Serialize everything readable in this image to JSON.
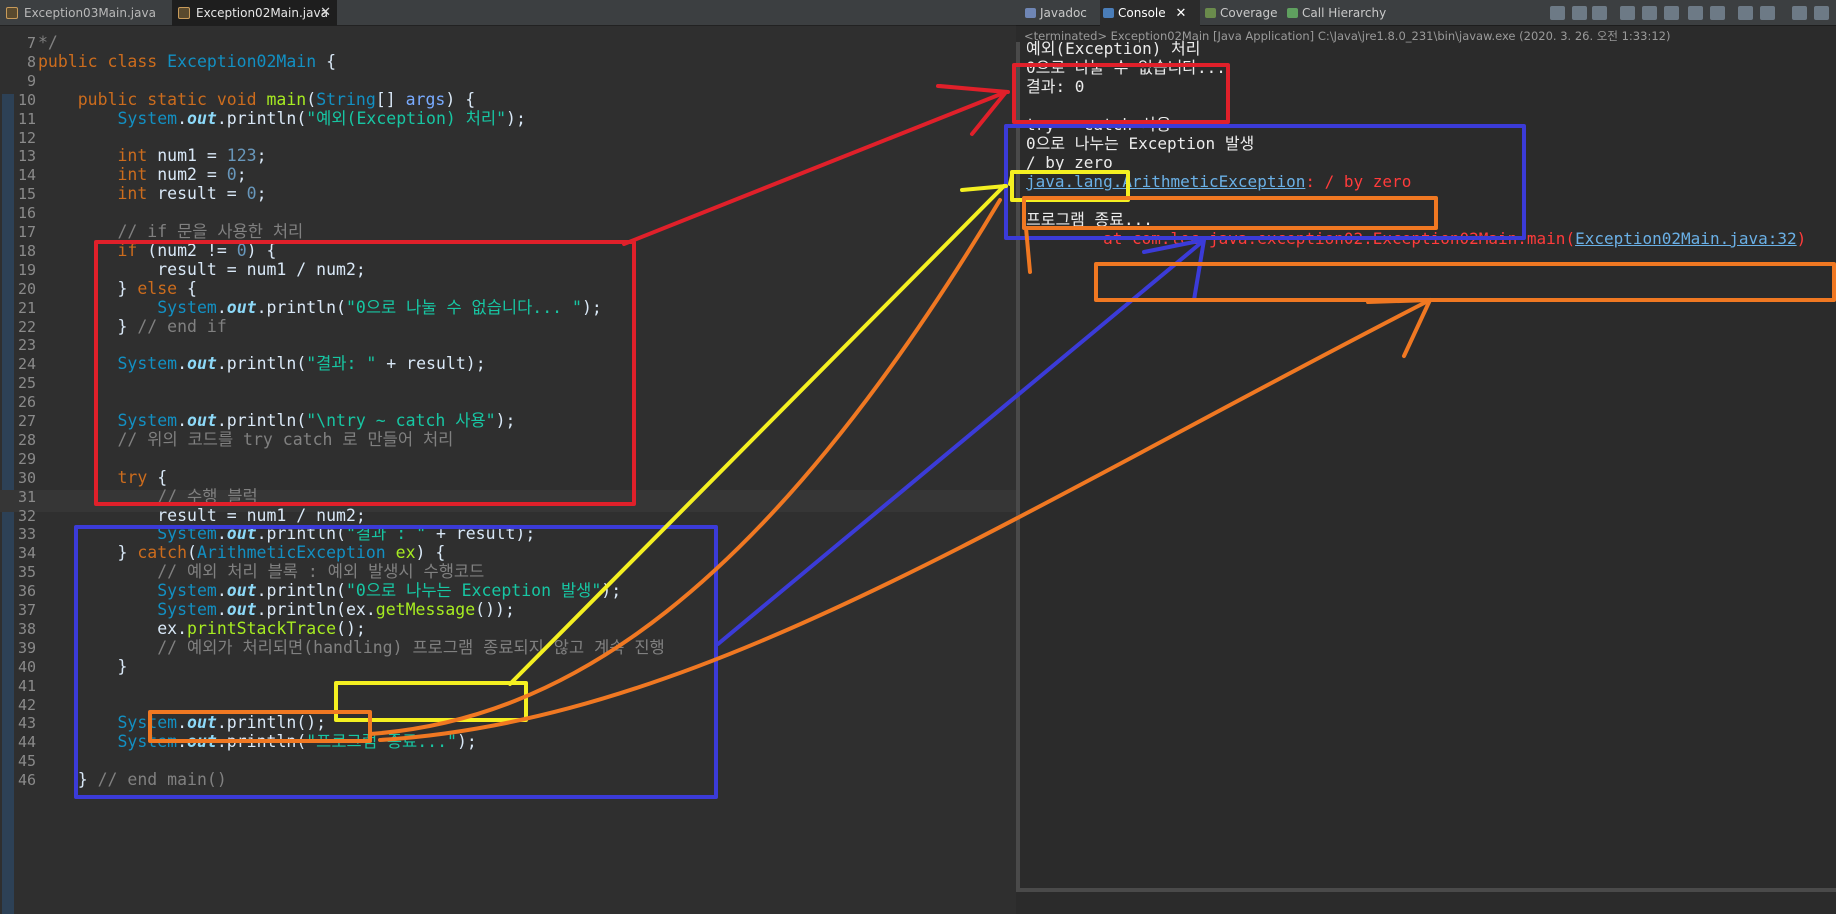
{
  "editor": {
    "tabs": [
      {
        "label": "Exception03Main.java",
        "active": false
      },
      {
        "label": "Exception02Main.java",
        "active": true,
        "close": "✕"
      }
    ],
    "lines": [
      {
        "n": "7",
        "parts": [
          [
            "cm",
            "*/"
          ]
        ]
      },
      {
        "n": "8",
        "parts": [
          [
            "kw",
            "public class "
          ],
          [
            "cls",
            "Exception02Main"
          ],
          [
            "pl",
            " {"
          ]
        ]
      },
      {
        "n": "9",
        "parts": []
      },
      {
        "n": "10",
        "parts": [
          [
            "pl",
            "    "
          ],
          [
            "kw",
            "public static void "
          ],
          [
            "mth",
            "main"
          ],
          [
            "pl",
            "("
          ],
          [
            "typ",
            "String"
          ],
          [
            "pl",
            "[] "
          ],
          [
            "var",
            "args"
          ],
          [
            "pl",
            ") {"
          ]
        ]
      },
      {
        "n": "11",
        "parts": [
          [
            "pl",
            "        "
          ],
          [
            "typ",
            "System"
          ],
          [
            "pl",
            "."
          ],
          [
            "fld",
            "out"
          ],
          [
            "pl",
            ".println("
          ],
          [
            "str",
            "\"예외(Exception) 처리\""
          ],
          [
            "pl",
            ");"
          ]
        ]
      },
      {
        "n": "12",
        "parts": []
      },
      {
        "n": "13",
        "parts": [
          [
            "pl",
            "        "
          ],
          [
            "kw",
            "int "
          ],
          [
            "pl",
            "num1 = "
          ],
          [
            "num",
            "123"
          ],
          [
            "pl",
            ";"
          ]
        ]
      },
      {
        "n": "14",
        "parts": [
          [
            "pl",
            "        "
          ],
          [
            "kw",
            "int "
          ],
          [
            "pl",
            "num2 = "
          ],
          [
            "num",
            "0"
          ],
          [
            "pl",
            ";"
          ]
        ]
      },
      {
        "n": "15",
        "parts": [
          [
            "pl",
            "        "
          ],
          [
            "kw",
            "int "
          ],
          [
            "pl",
            "result = "
          ],
          [
            "num",
            "0"
          ],
          [
            "pl",
            ";"
          ]
        ]
      },
      {
        "n": "16",
        "parts": []
      },
      {
        "n": "17",
        "parts": [
          [
            "pl",
            "        "
          ],
          [
            "cm",
            "// if 문을 사용한 처리"
          ]
        ]
      },
      {
        "n": "18",
        "parts": [
          [
            "pl",
            "        "
          ],
          [
            "kw",
            "if "
          ],
          [
            "pl",
            "(num2 != "
          ],
          [
            "num",
            "0"
          ],
          [
            "pl",
            ") {"
          ]
        ]
      },
      {
        "n": "19",
        "parts": [
          [
            "pl",
            "            result = num1 / num2;"
          ]
        ]
      },
      {
        "n": "20",
        "parts": [
          [
            "pl",
            "        } "
          ],
          [
            "kw",
            "else "
          ],
          [
            "pl",
            "{"
          ]
        ]
      },
      {
        "n": "21",
        "parts": [
          [
            "pl",
            "            "
          ],
          [
            "typ",
            "System"
          ],
          [
            "pl",
            "."
          ],
          [
            "fld",
            "out"
          ],
          [
            "pl",
            ".println("
          ],
          [
            "str",
            "\"0으로 나눌 수 없습니다... \""
          ],
          [
            "pl",
            ");"
          ]
        ]
      },
      {
        "n": "22",
        "parts": [
          [
            "pl",
            "        } "
          ],
          [
            "cm",
            "// end if"
          ]
        ]
      },
      {
        "n": "23",
        "parts": []
      },
      {
        "n": "24",
        "parts": [
          [
            "pl",
            "        "
          ],
          [
            "typ",
            "System"
          ],
          [
            "pl",
            "."
          ],
          [
            "fld",
            "out"
          ],
          [
            "pl",
            ".println("
          ],
          [
            "str",
            "\"결과: \""
          ],
          [
            "pl",
            " + result);"
          ]
        ]
      },
      {
        "n": "25",
        "parts": []
      },
      {
        "n": "26",
        "parts": []
      },
      {
        "n": "27",
        "parts": [
          [
            "pl",
            "        "
          ],
          [
            "typ",
            "System"
          ],
          [
            "pl",
            "."
          ],
          [
            "fld",
            "out"
          ],
          [
            "pl",
            ".println("
          ],
          [
            "str",
            "\"\\ntry ~ catch 사용\""
          ],
          [
            "pl",
            ");"
          ]
        ]
      },
      {
        "n": "28",
        "parts": [
          [
            "pl",
            "        "
          ],
          [
            "cm",
            "// 위의 코드를 try catch 로 만들어 처리"
          ]
        ]
      },
      {
        "n": "29",
        "parts": []
      },
      {
        "n": "30",
        "parts": [
          [
            "pl",
            "        "
          ],
          [
            "kw",
            "try "
          ],
          [
            "pl",
            "{"
          ]
        ]
      },
      {
        "n": "31",
        "parts": [
          [
            "pl",
            "            "
          ],
          [
            "cm",
            "// 수행 블럭"
          ]
        ]
      },
      {
        "n": "32",
        "parts": [
          [
            "pl",
            "            result = num1 / num2;"
          ]
        ]
      },
      {
        "n": "33",
        "parts": [
          [
            "pl",
            "            "
          ],
          [
            "typ",
            "System"
          ],
          [
            "pl",
            "."
          ],
          [
            "fld",
            "out"
          ],
          [
            "pl",
            ".println("
          ],
          [
            "str",
            "\"결과 : \""
          ],
          [
            "pl",
            " + result);"
          ]
        ]
      },
      {
        "n": "34",
        "parts": [
          [
            "pl",
            "        } "
          ],
          [
            "kw",
            "catch"
          ],
          [
            "pl",
            "("
          ],
          [
            "cls",
            "ArithmeticException "
          ],
          [
            "mth",
            "ex"
          ],
          [
            "pl",
            ") {"
          ]
        ]
      },
      {
        "n": "35",
        "parts": [
          [
            "pl",
            "            "
          ],
          [
            "cm",
            "// 예외 처리 블록 : 예외 발생시 수행코드"
          ]
        ]
      },
      {
        "n": "36",
        "parts": [
          [
            "pl",
            "            "
          ],
          [
            "typ",
            "System"
          ],
          [
            "pl",
            "."
          ],
          [
            "fld",
            "out"
          ],
          [
            "pl",
            ".println("
          ],
          [
            "str",
            "\"0으로 나누는 Exception 발생\""
          ],
          [
            "pl",
            ");"
          ]
        ]
      },
      {
        "n": "37",
        "parts": [
          [
            "pl",
            "            "
          ],
          [
            "typ",
            "System"
          ],
          [
            "pl",
            "."
          ],
          [
            "fld",
            "out"
          ],
          [
            "pl",
            ".println(ex."
          ],
          [
            "mth",
            "getMessage"
          ],
          [
            "pl",
            "());"
          ]
        ]
      },
      {
        "n": "38",
        "parts": [
          [
            "pl",
            "            ex."
          ],
          [
            "mth",
            "printStackTrace"
          ],
          [
            "pl",
            "();"
          ]
        ]
      },
      {
        "n": "39",
        "parts": [
          [
            "pl",
            "            "
          ],
          [
            "cm",
            "// 예외가 처리되면(handling) 프로그램 종료되지 않고 계속 진행"
          ]
        ]
      },
      {
        "n": "40",
        "parts": [
          [
            "pl",
            "        }"
          ]
        ]
      },
      {
        "n": "41",
        "parts": []
      },
      {
        "n": "42",
        "parts": []
      },
      {
        "n": "43",
        "parts": [
          [
            "pl",
            "        "
          ],
          [
            "typ",
            "System"
          ],
          [
            "pl",
            "."
          ],
          [
            "fld",
            "out"
          ],
          [
            "pl",
            ".println();"
          ]
        ]
      },
      {
        "n": "44",
        "parts": [
          [
            "pl",
            "        "
          ],
          [
            "typ",
            "System"
          ],
          [
            "pl",
            "."
          ],
          [
            "fld",
            "out"
          ],
          [
            "pl",
            ".println("
          ],
          [
            "str",
            "\"프로그램 종료...\""
          ],
          [
            "pl",
            ");"
          ]
        ]
      },
      {
        "n": "45",
        "parts": []
      },
      {
        "n": "46",
        "parts": [
          [
            "pl",
            "    } "
          ],
          [
            "cm",
            "// end main()"
          ]
        ]
      }
    ]
  },
  "views": {
    "tabs": [
      {
        "label": "Javadoc",
        "icon": "javadoc-icon"
      },
      {
        "label": "Console",
        "icon": "console-icon",
        "active": true,
        "close": "✕"
      },
      {
        "label": "Coverage",
        "icon": "coverage-icon"
      },
      {
        "label": "Call Hierarchy",
        "icon": "call-hierarchy-icon"
      }
    ],
    "toolbar_icons": [
      "clear-console-icon",
      "remove-launch-icon",
      "remove-all-icon",
      "scroll-lock-icon",
      "word-wrap-icon",
      "pin-console-icon",
      "display-selected-icon",
      "open-console-icon",
      "new-console-icon",
      "view-menu-icon",
      "minimize-icon",
      "maximize-icon"
    ]
  },
  "console": {
    "status": "<terminated> Exception02Main [Java Application] C:\\Java\\jre1.8.0_231\\bin\\javaw.exe (2020. 3. 26. 오전 1:33:12)",
    "lines": [
      {
        "text": "예외(Exception) 처리"
      },
      {
        "text": "0으로 나눌 수 없습니다..."
      },
      {
        "text": "결과: 0"
      },
      {
        "text": ""
      },
      {
        "text": "try ~ catch 사용"
      },
      {
        "text": "0으로 나누는 Exception 발생"
      },
      {
        "text": "/ by zero"
      },
      {
        "link": "java.lang.ArithmeticException",
        "err": ": / by zero"
      },
      {
        "text": ""
      },
      {
        "text": "프로그램 종료..."
      },
      {
        "err_prefix": "        at com.lec.java.exception02.Exception02Main.main(",
        "link": "Exception02Main.java:32",
        "err_suffix": ")"
      }
    ]
  },
  "colors": {
    "annot_red": "#e0202a",
    "annot_blue": "#3b3bd8",
    "annot_yellow": "#f4f021",
    "annot_orange": "#f07822"
  }
}
